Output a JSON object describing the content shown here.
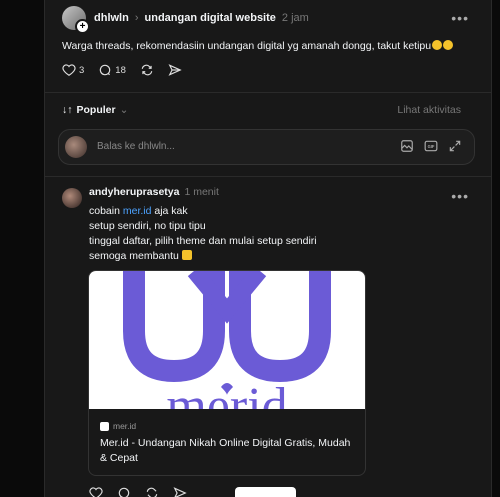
{
  "post": {
    "username": "dhlwln",
    "community": "undangan digital website",
    "time": "2 jam",
    "text": "Warga threads, rekomendasiin undangan digital yg amanah dongg, takut ketipu",
    "likes": "3",
    "comments": "18"
  },
  "sort": {
    "label": "Populer",
    "activity": "Lihat aktivitas"
  },
  "reply": {
    "placeholder": "Balas ke dhlwln..."
  },
  "comment": {
    "username": "andyheruprasetya",
    "time": "1 menit",
    "line1_prefix": "cobain ",
    "line1_link": "mer.id",
    "line1_suffix": " aja kak",
    "line2": "setup sendiri, no tipu tipu",
    "line3": "tinggal daftar, pilih theme dan mulai setup sendiri",
    "line4": "semoga membantu ",
    "card": {
      "domain": "mer.id",
      "title": "Mer.id - Undangan Nikah Online Digital Gratis, Mudah & Cepat",
      "logo_text": "merid",
      "brand_color": "#6b5bd6"
    }
  }
}
